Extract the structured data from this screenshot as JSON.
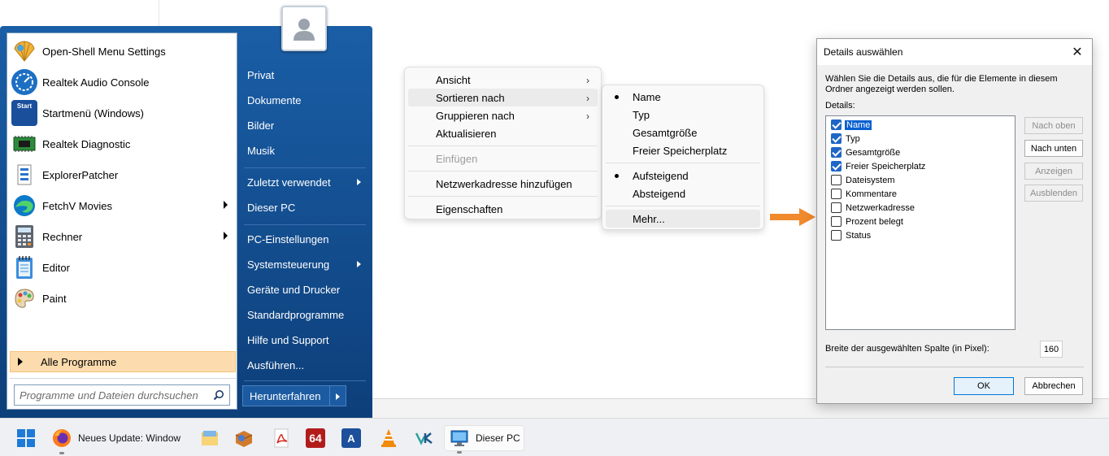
{
  "start_menu": {
    "programs": [
      {
        "label": "Open-Shell Menu Settings",
        "icon": "shell-icon",
        "arrow": false
      },
      {
        "label": "Realtek Audio Console",
        "icon": "realtek-audio-icon",
        "arrow": false
      },
      {
        "label": "Startmenü (Windows)",
        "icon": "startmenu-icon",
        "arrow": false
      },
      {
        "label": "Realtek Diagnostic",
        "icon": "chip-icon",
        "arrow": false
      },
      {
        "label": "ExplorerPatcher",
        "icon": "explorerpatcher-icon",
        "arrow": false
      },
      {
        "label": "FetchV Movies",
        "icon": "edge-icon",
        "arrow": true
      },
      {
        "label": "Rechner",
        "icon": "calculator-icon",
        "arrow": true
      },
      {
        "label": "Editor",
        "icon": "notepad-icon",
        "arrow": false
      },
      {
        "label": "Paint",
        "icon": "paint-icon",
        "arrow": false
      }
    ],
    "all_programs": "Alle Programme",
    "search_placeholder": "Programme und Dateien durchsuchen",
    "right_items": [
      {
        "label": "Privat",
        "arrow": false
      },
      {
        "label": "Dokumente",
        "arrow": false
      },
      {
        "label": "Bilder",
        "arrow": false
      },
      {
        "label": "Musik",
        "arrow": false
      },
      {
        "label": "Zuletzt verwendet",
        "arrow": true
      },
      {
        "label": "Dieser PC",
        "arrow": false
      },
      {
        "label": "PC-Einstellungen",
        "arrow": false
      },
      {
        "label": "Systemsteuerung",
        "arrow": true
      },
      {
        "label": "Geräte und Drucker",
        "arrow": false
      },
      {
        "label": "Standardprogramme",
        "arrow": false
      },
      {
        "label": "Hilfe und Support",
        "arrow": false
      },
      {
        "label": "Ausführen...",
        "arrow": false
      }
    ],
    "shutdown": "Herunterfahren"
  },
  "context_menu": {
    "items": [
      {
        "label": "Ansicht",
        "submenu": true,
        "disabled": false,
        "highlighted": false
      },
      {
        "label": "Sortieren nach",
        "submenu": true,
        "disabled": false,
        "highlighted": true
      },
      {
        "label": "Gruppieren nach",
        "submenu": true,
        "disabled": false,
        "highlighted": false
      },
      {
        "label": "Aktualisieren",
        "submenu": false,
        "disabled": false,
        "highlighted": false
      },
      {
        "label": "Einfügen",
        "submenu": false,
        "disabled": true,
        "highlighted": false
      },
      {
        "label": "Netzwerkadresse hinzufügen",
        "submenu": false,
        "disabled": false,
        "highlighted": false
      },
      {
        "label": "Eigenschaften",
        "submenu": false,
        "disabled": false,
        "highlighted": false
      }
    ],
    "submenu": [
      {
        "label": "Name",
        "selected": true
      },
      {
        "label": "Typ",
        "selected": false
      },
      {
        "label": "Gesamtgröße",
        "selected": false
      },
      {
        "label": "Freier Speicherplatz",
        "selected": false
      },
      {
        "label": "Aufsteigend",
        "selected": true
      },
      {
        "label": "Absteigend",
        "selected": false
      },
      {
        "label": "Mehr...",
        "selected": false
      }
    ]
  },
  "dialog": {
    "title": "Details auswählen",
    "description": "Wählen Sie die Details aus, die für die Elemente in diesem Ordner angezeigt werden sollen.",
    "details_label": "Details:",
    "details": [
      {
        "label": "Name",
        "checked": true,
        "selected": true
      },
      {
        "label": "Typ",
        "checked": true,
        "selected": false
      },
      {
        "label": "Gesamtgröße",
        "checked": true,
        "selected": false
      },
      {
        "label": "Freier Speicherplatz",
        "checked": true,
        "selected": false
      },
      {
        "label": "Dateisystem",
        "checked": false,
        "selected": false
      },
      {
        "label": "Kommentare",
        "checked": false,
        "selected": false
      },
      {
        "label": "Netzwerkadresse",
        "checked": false,
        "selected": false
      },
      {
        "label": "Prozent belegt",
        "checked": false,
        "selected": false
      },
      {
        "label": "Status",
        "checked": false,
        "selected": false
      }
    ],
    "buttons": [
      {
        "label": "Nach oben",
        "enabled": false
      },
      {
        "label": "Nach unten",
        "enabled": true
      },
      {
        "label": "Anzeigen",
        "enabled": false
      },
      {
        "label": "Ausblenden",
        "enabled": false
      }
    ],
    "width_label": "Breite der ausgewählten Spalte (in Pixel):",
    "width_value": "160",
    "ok": "OK",
    "cancel": "Abbrechen"
  },
  "taskbar": {
    "items": [
      {
        "icon": "windows-start-icon",
        "label": ""
      },
      {
        "icon": "firefox-icon",
        "label": "Neues Update: Window"
      },
      {
        "icon": "explorer-folder-icon",
        "label": ""
      },
      {
        "icon": "package-icon",
        "label": ""
      },
      {
        "icon": "pdf-icon",
        "label": ""
      },
      {
        "icon": "aida64-icon",
        "label": "64"
      },
      {
        "icon": "font-app-icon",
        "label": "A"
      },
      {
        "icon": "vlc-icon",
        "label": ""
      },
      {
        "icon": "vk-icon",
        "label": ""
      },
      {
        "icon": "this-pc-icon",
        "label": "Dieser PC"
      }
    ]
  },
  "colors": {
    "start_menu_blue": "#0f4a8a",
    "highlight_orange": "#fcdcae",
    "arrow_orange": "#f08a2c",
    "checkbox_blue": "#1e66c6",
    "selection_blue": "#0a60d0"
  }
}
